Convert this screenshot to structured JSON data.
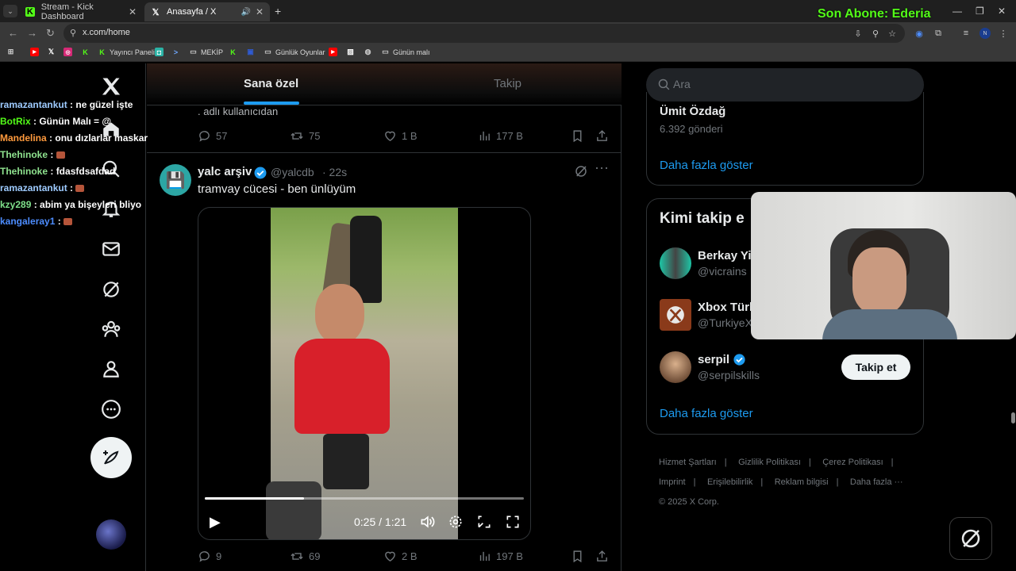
{
  "browser": {
    "tabs": [
      {
        "title": "Stream - Kick Dashboard",
        "icon": "kick-icon"
      },
      {
        "title": "Anasayfa / X",
        "icon": "x-icon"
      }
    ],
    "url": "x.com/home",
    "bookmarks": [
      "Yayıncı Paneli",
      "MEKİP",
      "Günlük Oyunlar",
      "Günün malı"
    ]
  },
  "overlay": {
    "son_abone": "Son Abone: Ederia",
    "chat": [
      {
        "user": "ramazantankut",
        "msg": "ne güzel işte",
        "color": "#9ecbff"
      },
      {
        "user": "BotRix",
        "msg": "Günün Malı",
        "tail": "= @",
        "color": "#53fc18"
      },
      {
        "user": "Mandelina",
        "msg": "onu dızlarlar maskar",
        "color": "#ff9a3d"
      },
      {
        "user": "Thehinoke",
        "msg": "",
        "color": "#8fe38f"
      },
      {
        "user": "Thehinoke",
        "msg": "fdasfdsafdad",
        "color": "#8fe38f"
      },
      {
        "user": "ramazantankut",
        "msg": "",
        "color": "#9ecbff"
      },
      {
        "user": "kzy289",
        "msg": "abim ya bişeyleri bliyo",
        "color": "#7ee08a"
      },
      {
        "user": "kangaleray1",
        "msg": "",
        "color": "#4d8dff"
      }
    ]
  },
  "feed": {
    "tabs": [
      "Sana özel",
      "Takip"
    ],
    "prev_post": {
      "text_tail": ". adlı kullanıcıdan",
      "replies": "57",
      "reposts": "75",
      "likes": "1 B",
      "views": "177 B"
    },
    "post": {
      "name": "yalc arşiv",
      "handle": "@yalcdb",
      "time": "· 22s",
      "text": "tramvay cücesi - ben ünlüyüm",
      "video_time": "0:25 / 1:21",
      "progress": 0.31,
      "replies": "9",
      "reposts": "69",
      "likes": "2 B",
      "views": "197 B"
    }
  },
  "sidebar": {
    "search_placeholder": "Ara",
    "trend_name": "Ümit Özdağ",
    "trend_count": "6.392 gönderi",
    "show_more": "Daha fazla göster",
    "who_to_follow_title": "Kimi takip e",
    "suggestions": [
      {
        "name": "Berkay Yi",
        "handle": "@vicrains"
      },
      {
        "name": "Xbox Türk",
        "handle": "@TurkiyeX"
      },
      {
        "name": "serpil",
        "handle": "@serpilskills",
        "button": "Takip et"
      }
    ],
    "show_more_2": "Daha fazla göster",
    "footer": [
      "Hizmet Şartları",
      "Gizlilik Politikası",
      "Çerez Politikası",
      "Imprint",
      "Erişilebilirlik",
      "Reklam bilgisi",
      "Daha fazla ···"
    ],
    "copyright": "© 2025 X Corp."
  },
  "colors": {
    "accent": "#1d9bf0",
    "kick_green": "#53fc18"
  }
}
